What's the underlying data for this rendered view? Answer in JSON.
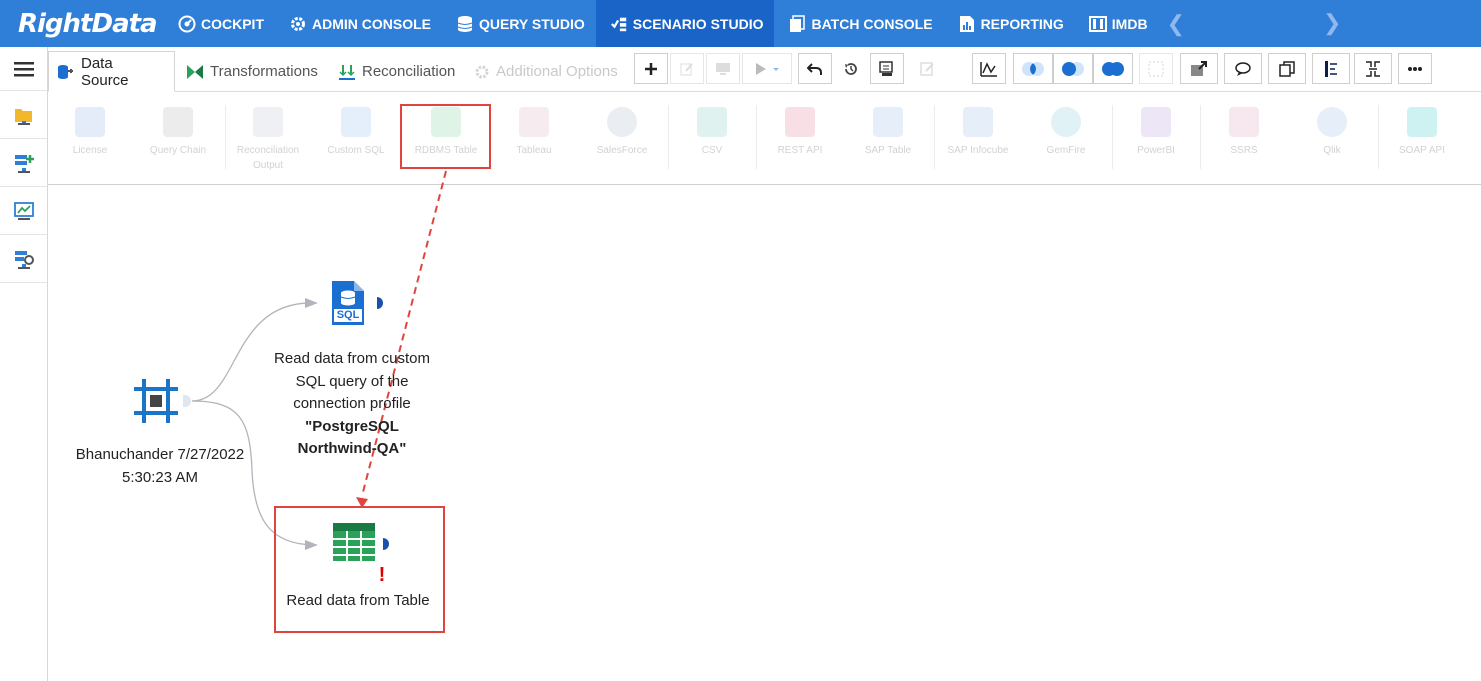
{
  "brand": {
    "logo_text": "RightData"
  },
  "nav": {
    "items": [
      {
        "label": "COCKPIT",
        "icon": "cockpit-icon"
      },
      {
        "label": "ADMIN CONSOLE",
        "icon": "gear-icon"
      },
      {
        "label": "QUERY STUDIO",
        "icon": "database-icon"
      },
      {
        "label": "SCENARIO STUDIO",
        "icon": "scenario-icon",
        "active": true
      },
      {
        "label": "BATCH CONSOLE",
        "icon": "batch-icon"
      },
      {
        "label": "REPORTING",
        "icon": "report-icon"
      },
      {
        "label": "IMDB",
        "icon": "imdb-icon"
      }
    ]
  },
  "tabs": {
    "data_source": "Data Source",
    "transformations": "Transformations",
    "reconciliation": "Reconciliation",
    "additional_options": "Additional Options"
  },
  "ribbon": {
    "items": [
      "License",
      "Query Chain",
      "Reconciliation Output",
      "Custom SQL",
      "RDBMS Table",
      "Tableau",
      "SalesForce",
      "CSV",
      "REST API",
      "SAP Table",
      "SAP Infocube",
      "GemFire",
      "PowerBI",
      "SSRS",
      "Qlik",
      "SOAP API"
    ]
  },
  "canvas": {
    "start_node": {
      "line1": "Bhanuchander 7/27/2022",
      "line2": "5:30:23 AM"
    },
    "sql_node": {
      "icon_text": "SQL",
      "line1": "Read data from custom",
      "line2": "SQL query of the",
      "line3": "connection profile",
      "bold1": "\"PostgreSQL",
      "bold2": "Northwind-QA\""
    },
    "table_node": {
      "label": "Read data from Table",
      "warning": "!"
    }
  },
  "colors": {
    "nav_bg": "#2f7fd8",
    "nav_active": "#1964c6",
    "highlight": "#e0443f",
    "table_green": "#2aa35a",
    "sql_blue": "#1b6fd1"
  }
}
